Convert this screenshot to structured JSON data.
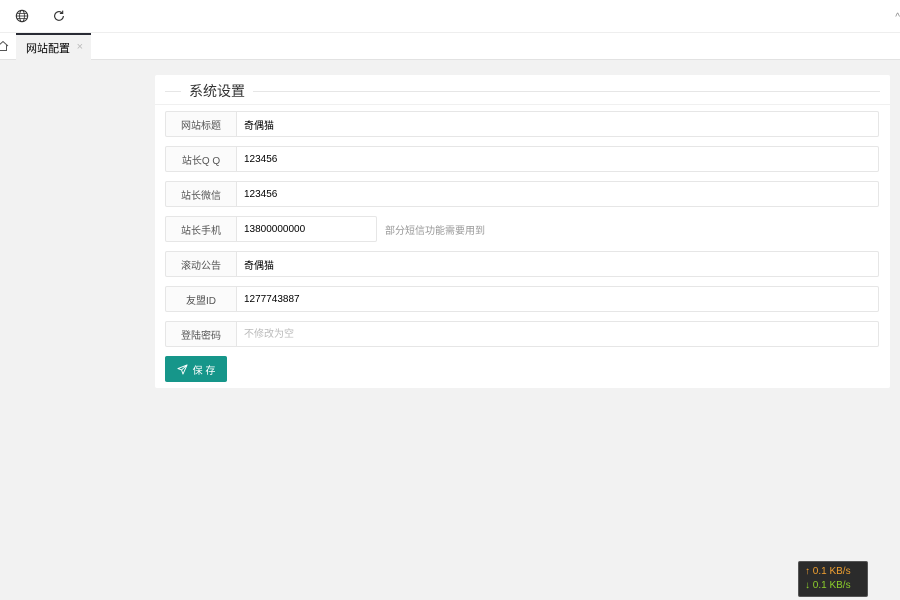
{
  "toolbar": {
    "icons": [
      "globe-icon",
      "refresh-icon"
    ],
    "edge_glyph": "^"
  },
  "tabs": {
    "home_icon": "home-icon",
    "active_label": "网站配置",
    "close_glyph": "×"
  },
  "section": {
    "title": "系统设置"
  },
  "form": {
    "fields": [
      {
        "label": "网站标题",
        "value": "奇偶猫",
        "placeholder": ""
      },
      {
        "label": "站长Q Q",
        "value": "123456",
        "placeholder": ""
      },
      {
        "label": "站长微信",
        "value": "123456",
        "placeholder": ""
      },
      {
        "label": "站长手机",
        "value": "13800000000",
        "placeholder": "",
        "aux": "部分短信功能需要用到"
      },
      {
        "label": "滚动公告",
        "value": "奇偶猫",
        "placeholder": ""
      },
      {
        "label": "友盟ID",
        "value": "1277743887",
        "placeholder": ""
      },
      {
        "label": "登陆密码",
        "value": "",
        "placeholder": "不修改为空"
      }
    ],
    "save_label": "保 存"
  },
  "netspeed": {
    "up": "↑ 0.1 KB/s",
    "down": "↓ 0.1 KB/s"
  },
  "colors": {
    "accent": "#16968a",
    "tab_indicator": "#292b34",
    "background": "#f2f2f2"
  }
}
